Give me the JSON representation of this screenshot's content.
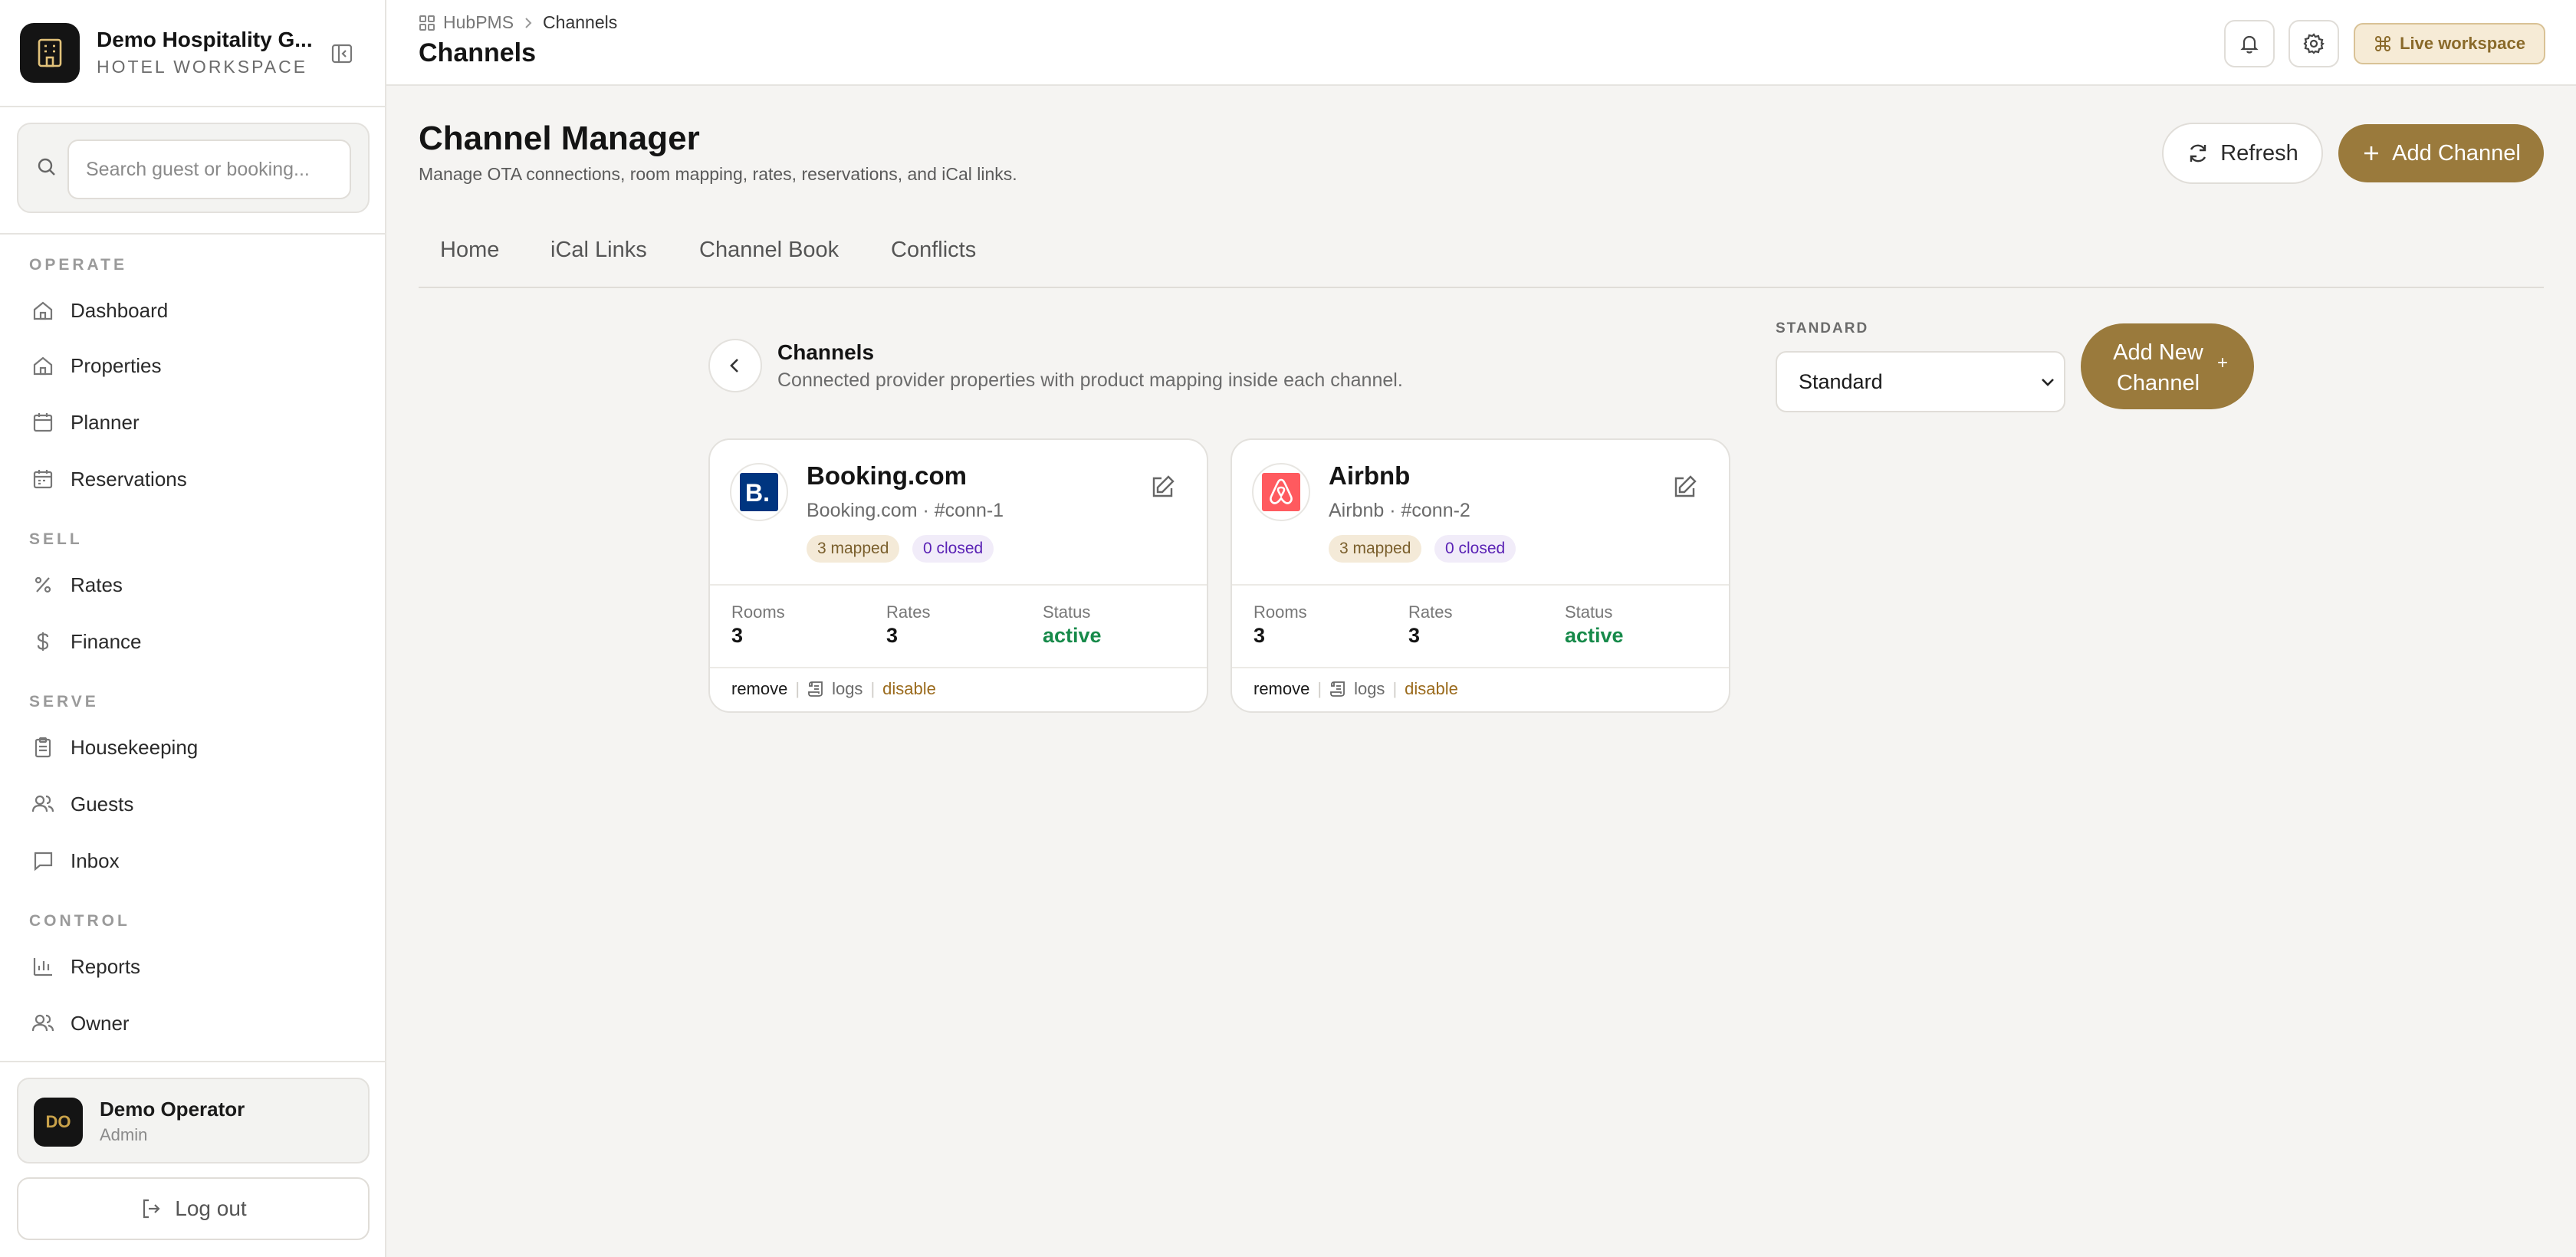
{
  "sidebar": {
    "brand_name": "Demo Hospitality G...",
    "brand_sub": "HOTEL WORKSPACE",
    "search_placeholder": "Search guest or booking...",
    "sections": {
      "operate": "OPERATE",
      "sell": "SELL",
      "serve": "SERVE",
      "control": "CONTROL"
    },
    "items": {
      "dashboard": "Dashboard",
      "properties": "Properties",
      "planner": "Planner",
      "reservations": "Reservations",
      "rates": "Rates",
      "finance": "Finance",
      "housekeeping": "Housekeeping",
      "guests": "Guests",
      "inbox": "Inbox",
      "reports": "Reports",
      "owner": "Owner"
    },
    "user": {
      "initials": "DO",
      "name": "Demo Operator",
      "role": "Admin"
    },
    "logout_label": "Log out"
  },
  "topbar": {
    "breadcrumb_root": "HubPMS",
    "breadcrumb_current": "Channels",
    "title": "Channels",
    "live_label": "Live workspace"
  },
  "main": {
    "title": "Channel Manager",
    "subtitle": "Manage OTA connections, room mapping, rates, reservations, and iCal links.",
    "refresh_label": "Refresh",
    "add_label": "Add Channel",
    "tabs": [
      "Home",
      "iCal Links",
      "Channel Book",
      "Conflicts"
    ],
    "section_title": "Channels",
    "section_sub": "Connected provider properties with product mapping inside each channel.",
    "standard_label": "STANDARD",
    "standard_value": "Standard",
    "add_new_label": "Add New Channel",
    "add_new_plus": "+"
  },
  "cards": [
    {
      "name": "Booking.com",
      "meta": "Booking.com · #conn-1",
      "mapped": "3 mapped",
      "closed": "0 closed",
      "rooms_label": "Rooms",
      "rooms": "3",
      "rates_label": "Rates",
      "rates": "3",
      "status_label": "Status",
      "status": "active",
      "remove": "remove",
      "logs": "logs",
      "disable": "disable",
      "logo_icon": "booking-logo",
      "logo_color": "#003580"
    },
    {
      "name": "Airbnb",
      "meta": "Airbnb · #conn-2",
      "mapped": "3 mapped",
      "closed": "0 closed",
      "rooms_label": "Rooms",
      "rooms": "3",
      "rates_label": "Rates",
      "rates": "3",
      "status_label": "Status",
      "status": "active",
      "remove": "remove",
      "logs": "logs",
      "disable": "disable",
      "logo_icon": "airbnb-logo",
      "logo_color": "#ff5a5f"
    }
  ],
  "colors": {
    "accent": "#9a7a3c",
    "active": "#178a4a",
    "closed_pill": "#5a22b5"
  }
}
